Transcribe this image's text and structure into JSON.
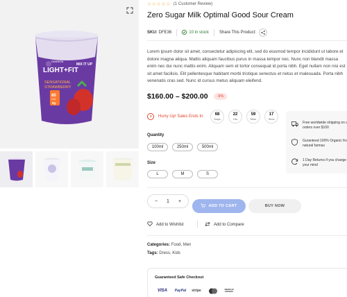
{
  "rating": {
    "stars": "☆☆☆☆☆",
    "review_text": "(1 Customer Review)"
  },
  "product": {
    "title": "Zero Sugar Milk Optimal Good Sour Cream",
    "sku_label": "SKU:",
    "sku": "DFE36",
    "stock": "10 in stock",
    "share_label": "Share This Product:",
    "description": "Lorem ipsum dolor sit amet, consectetur adipiscing elit, sed do eiusmod tempor incididunt ut labore et dolore magna aliqua. Mattis aliquam faucibus purus in massa tempor nec. Nunc non blandit massa enim nec dui nunc mattis enim. Aliquam sem et tortor consequat id porta nibh. Eget nullam non nisi est sit amet facilisis. Elit pellentesque habitant morbi tristique senectus et netus et malesuada. Porta nibh venenatis cras sed. Nunc id cursus metus aliquam eleifend.",
    "price": "$160.00 – $200.00",
    "discount_badge": "-9%"
  },
  "gallery": {
    "brand": "DANNON",
    "product_line": "LIGHT+FIT",
    "mix_text": "MIX IT UP",
    "flavor_1": "SENSATIONAL",
    "flavor_2": "STRAWBERRY",
    "calories": "80",
    "calories_unit": "CAL",
    "protein": "5g"
  },
  "sale": {
    "label": "Hurry Up! Sales Ends In:",
    "countdown": [
      {
        "value": "68",
        "unit": "Days"
      },
      {
        "value": "22",
        "unit": "Hrs"
      },
      {
        "value": "59",
        "unit": "Mins"
      },
      {
        "value": "17",
        "unit": "Secs"
      }
    ]
  },
  "options": {
    "quantity_label": "Quantity",
    "quantity_options": [
      "100ml",
      "250ml",
      "500ml"
    ],
    "size_label": "Size",
    "size_options": [
      "L",
      "M",
      "S"
    ]
  },
  "cart": {
    "qty_minus": "−",
    "qty_value": "1",
    "qty_plus": "+",
    "add_to_cart": "ADD TO CART",
    "buy_now": "BUY NOW"
  },
  "actions": {
    "wishlist": "Add to Wishlist",
    "compare": "Add to Compare"
  },
  "taxonomy": {
    "categories_label": "Categories:",
    "categories": "Food, Men",
    "tags_label": "Tags:",
    "tags": "Dress, Kids"
  },
  "checkout": {
    "title": "Guaranteed Safe Checkout",
    "methods": [
      "VISA",
      "PayPal",
      "stripe",
      "mastercard",
      "AMERICAN EXPRESS"
    ]
  },
  "features": [
    {
      "icon": "truck-icon",
      "text": "Free worldwide shipping on all orders over $100"
    },
    {
      "icon": "shield-icon",
      "text": "Guranteed 100% Organic from natural farmas"
    },
    {
      "icon": "refresh-icon",
      "text": "1 Day Returns if you change your mind"
    }
  ],
  "colors": {
    "accent": "#9fb5ee",
    "sale_red": "#e0452b",
    "stock_green": "#2e7d32",
    "cup_purple": "#5b2d8e"
  }
}
